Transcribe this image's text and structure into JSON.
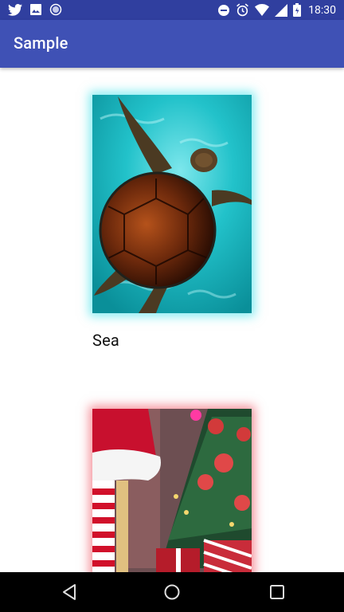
{
  "status_bar": {
    "time": "18:30",
    "left_icons": [
      "twitter-icon",
      "image-icon",
      "sync-icon"
    ],
    "right_icons": [
      "do-not-disturb-icon",
      "alarm-icon",
      "wifi-icon",
      "signal-icon",
      "battery-icon"
    ]
  },
  "app_bar": {
    "title": "Sample"
  },
  "cards": [
    {
      "label": "Sea",
      "glow_color": "#22dce6",
      "image": "sea-turtle"
    },
    {
      "label": "",
      "glow_color": "#eb283c",
      "image": "christmas-tree"
    }
  ],
  "nav_bar": {
    "buttons": [
      "back-icon",
      "home-icon",
      "recents-icon"
    ]
  },
  "colors": {
    "status_bar": "#303f9f",
    "app_bar": "#3f51b5",
    "background": "#ffffff",
    "nav_bar": "#000000"
  }
}
